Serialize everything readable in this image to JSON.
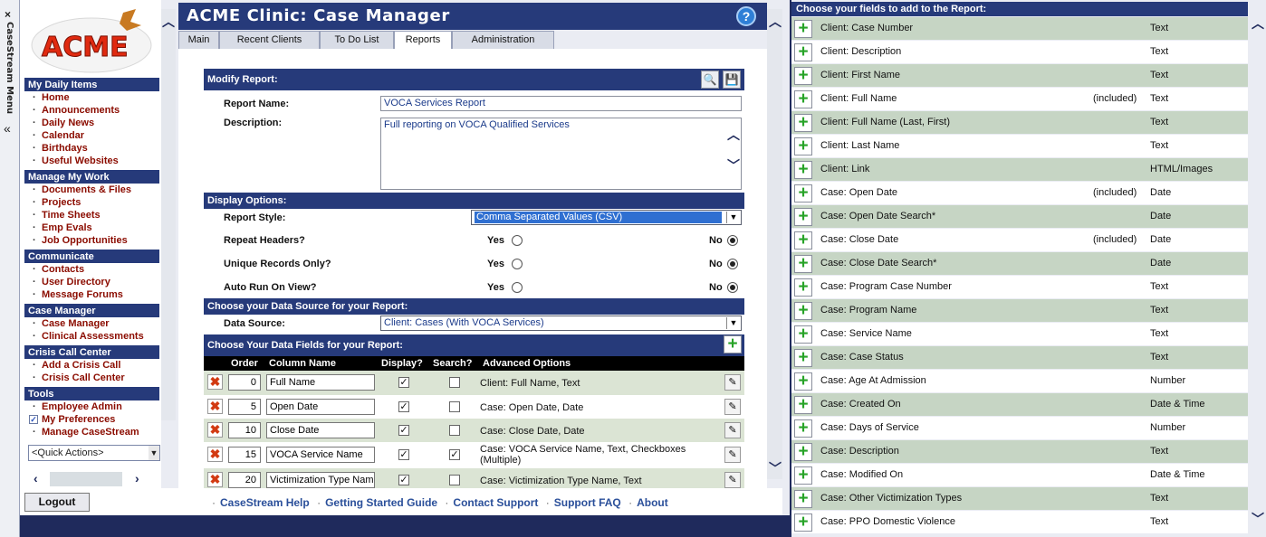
{
  "sidetab": {
    "close": "×",
    "label": "CaseStream Menu",
    "collapse": "«"
  },
  "nav": {
    "sections": [
      {
        "title": "My Daily Items",
        "items": [
          "Home",
          "Announcements",
          "Daily News",
          "Calendar",
          "Birthdays",
          "Useful Websites"
        ]
      },
      {
        "title": "Manage My Work",
        "items": [
          "Documents & Files",
          "Projects",
          "Time Sheets",
          "Emp Evals",
          "Job Opportunities"
        ]
      },
      {
        "title": "Communicate",
        "items": [
          "Contacts",
          "User Directory",
          "Message Forums"
        ]
      },
      {
        "title": "Case Manager",
        "items": [
          "Case Manager",
          "Clinical Assessments"
        ]
      },
      {
        "title": "Crisis Call Center",
        "items": [
          "Add a Crisis Call",
          "Crisis Call Center"
        ]
      },
      {
        "title": "Tools",
        "items": [
          "Employee Admin",
          "My Preferences",
          "Manage CaseStream"
        ]
      }
    ],
    "quick_actions": "<Quick Actions>"
  },
  "header": {
    "title": "ACME Clinic: Case Manager",
    "help": "?"
  },
  "tabs": [
    "Main",
    "Recent Clients",
    "To Do List",
    "Reports",
    "Administration"
  ],
  "modify": {
    "heading": "Modify Report:",
    "report_name_label": "Report Name:",
    "report_name": "VOCA Services Report",
    "description_label": "Description:",
    "description": "Full reporting on VOCA Qualified Services"
  },
  "display": {
    "heading": "Display Options:",
    "style_label": "Report Style:",
    "style_value": "Comma Separated Values (CSV)",
    "repeat_label": "Repeat Headers?",
    "unique_label": "Unique Records Only?",
    "autorun_label": "Auto Run On View?",
    "yes": "Yes",
    "no": "No"
  },
  "source": {
    "heading": "Choose your Data Source for your Report:",
    "label": "Data Source:",
    "value": "Client: Cases (With VOCA Services)"
  },
  "fields": {
    "heading": "Choose Your Data Fields for your Report:",
    "columns": [
      "Order",
      "Column Name",
      "Display?",
      "Search?",
      "Advanced Options"
    ],
    "rows": [
      {
        "order": "0",
        "name": "Full Name",
        "display": true,
        "search": false,
        "adv": "Client: Full Name, Text"
      },
      {
        "order": "5",
        "name": "Open Date",
        "display": true,
        "search": false,
        "adv": "Case: Open Date, Date"
      },
      {
        "order": "10",
        "name": "Close Date",
        "display": true,
        "search": false,
        "adv": "Case: Close Date, Date"
      },
      {
        "order": "15",
        "name": "VOCA Service Name",
        "display": true,
        "search": true,
        "adv": "Case: VOCA Service Name, Text, Checkboxes (Multiple)"
      },
      {
        "order": "20",
        "name": "Victimization Type Name",
        "display": true,
        "search": false,
        "adv": "Case: Victimization Type Name, Text"
      }
    ]
  },
  "footer": {
    "logout": "Logout",
    "links": [
      "CaseStream Help",
      "Getting Started Guide",
      "Contact Support",
      "Support FAQ",
      "About"
    ]
  },
  "available": {
    "heading": "Choose your fields to add to the Report:",
    "rows": [
      {
        "name": "Client: Case Number",
        "inc": "",
        "type": "Text"
      },
      {
        "name": "Client: Description",
        "inc": "",
        "type": "Text"
      },
      {
        "name": "Client: First Name",
        "inc": "",
        "type": "Text"
      },
      {
        "name": "Client: Full Name",
        "inc": "(included)",
        "type": "Text"
      },
      {
        "name": "Client: Full Name (Last, First)",
        "inc": "",
        "type": "Text"
      },
      {
        "name": "Client: Last Name",
        "inc": "",
        "type": "Text"
      },
      {
        "name": "Client: Link",
        "inc": "",
        "type": "HTML/Images"
      },
      {
        "name": "Case: Open Date",
        "inc": "(included)",
        "type": "Date"
      },
      {
        "name": "Case: Open Date Search*",
        "inc": "",
        "type": "Date"
      },
      {
        "name": "Case: Close Date",
        "inc": "(included)",
        "type": "Date"
      },
      {
        "name": "Case: Close Date Search*",
        "inc": "",
        "type": "Date"
      },
      {
        "name": "Case: Program Case Number",
        "inc": "",
        "type": "Text"
      },
      {
        "name": "Case: Program Name",
        "inc": "",
        "type": "Text"
      },
      {
        "name": "Case: Service Name",
        "inc": "",
        "type": "Text"
      },
      {
        "name": "Case: Case Status",
        "inc": "",
        "type": "Text"
      },
      {
        "name": "Case: Age At Admission",
        "inc": "",
        "type": "Number"
      },
      {
        "name": "Case: Created On",
        "inc": "",
        "type": "Date & Time"
      },
      {
        "name": "Case: Days of Service",
        "inc": "",
        "type": "Number"
      },
      {
        "name": "Case: Description",
        "inc": "",
        "type": "Text"
      },
      {
        "name": "Case: Modified On",
        "inc": "",
        "type": "Date & Time"
      },
      {
        "name": "Case: Other Victimization Types",
        "inc": "",
        "type": "Text"
      },
      {
        "name": "Case: PPO Domestic Violence",
        "inc": "",
        "type": "Text"
      }
    ]
  }
}
